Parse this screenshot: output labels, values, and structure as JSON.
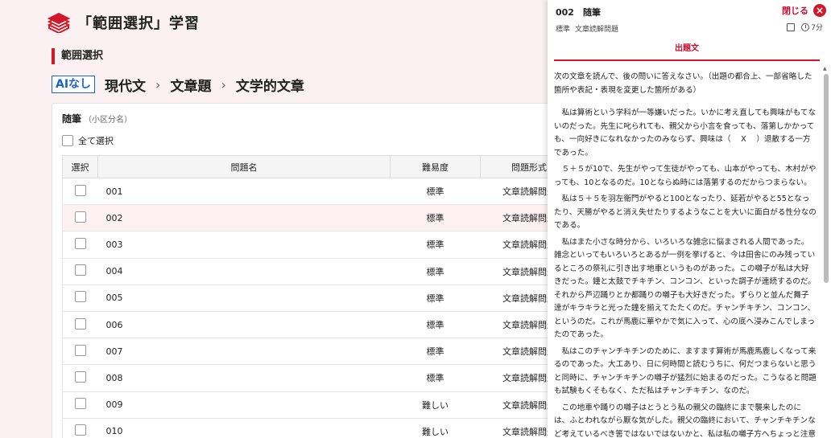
{
  "header": {
    "title": "「範囲選択」学習",
    "logo_icon": "books-icon"
  },
  "section": {
    "label": "範囲選択"
  },
  "breadcrumb": {
    "badge": "AIなし",
    "items": [
      "現代文",
      "文章題",
      "文学的文章"
    ]
  },
  "card": {
    "title": "随筆",
    "subtitle": "（小区分名）",
    "select_all": "全て選択",
    "columns": [
      "選択",
      "問題名",
      "難易度",
      "問題形式"
    ],
    "rows": [
      {
        "name": "001",
        "difficulty": "標準",
        "format": "文章読解問題"
      },
      {
        "name": "002",
        "difficulty": "標準",
        "format": "文章読解問題"
      },
      {
        "name": "003",
        "difficulty": "標準",
        "format": "文章読解問題"
      },
      {
        "name": "004",
        "difficulty": "標準",
        "format": "文章読解問題"
      },
      {
        "name": "005",
        "difficulty": "標準",
        "format": "文章読解問題"
      },
      {
        "name": "006",
        "difficulty": "標準",
        "format": "文章読解問題"
      },
      {
        "name": "007",
        "difficulty": "標準",
        "format": "文章読解問題"
      },
      {
        "name": "008",
        "difficulty": "標準",
        "format": "文章読解問題"
      },
      {
        "name": "009",
        "difficulty": "難しい",
        "format": "文章読解問題"
      },
      {
        "name": "010",
        "difficulty": "難しい",
        "format": "文章読解問題"
      }
    ]
  },
  "panel": {
    "id": "002",
    "title": "随筆",
    "close": "閉じる",
    "difficulty": "標準",
    "format": "文章読解問題",
    "time": "7分",
    "tab": "出題文",
    "paragraphs": [
      "次の文章を読んで、後の問いに答えなさい。（出題の都合上、一部省略した箇所や表記・表現を変更した箇所がある）",
      "私は算術という学科が一等嫌いだった。いかに考え直しても興味がもてないのだった。先生に叱られても、親父から小言を食っても、落第しかかっても、一向好きになれなかったのみならず、興味は（　 X　 ）退散する一方であった。",
      "５＋５が10で、先生がやって生徒がやっても、山本がやっても、木村がやっても、10となるのだ。10とならぬ時には落第するのだからつまらない。",
      "私は５＋５を羽左衛門がやると100となったり、延若がやると55となったり、天勝がやると消え失せたりするようなことを大いに面白がる性分なのである。",
      "私はまた小さな時分から、いろいろな雑念に悩まされる人間であった。雑念といってもいろいろとあるが一例を挙げると、今は田舎にのみ残っているところの祭礼に引き出す地車というものがあった。この囃子が私は大好きだった。鐘と太鼓でチキチン、コンコン、といった調子が連続するのだ。それから芦辺踊りとか都踊りの囃子も大好きだった。ずらりと並んだ舞子達がキラキラと光った鐘を揃えてたたくのだ。チャンチキチン、コンコン、というのだ。これが馬鹿に華やかで気に入って、心の底へ浸みこんでしまったのであった。",
      "私はこのチャンチキチンのために、ますます算術が馬鹿馬鹿しくなって来るのであった。大工あり、日に何時間と読むうちに、何だつまらないと思うと同時に、チャンチキチンの囃子が猛烈に始まるのだった。こうなると問題も試験もくそもなく、ただ私はチャンチキチン、なのだ。",
      "この地車や踊りの囃子はとうとう私の親父の臨終にまで襲来したのには、ふとわれながら厭な気がした。親父の臨終において、チャンチキチンなど考えているべき筈ではないではないかと、私は私の囃子方へちょっと注意をしてみたが、なかなかそれは聞き入れてくれないのであった。"
    ]
  }
}
